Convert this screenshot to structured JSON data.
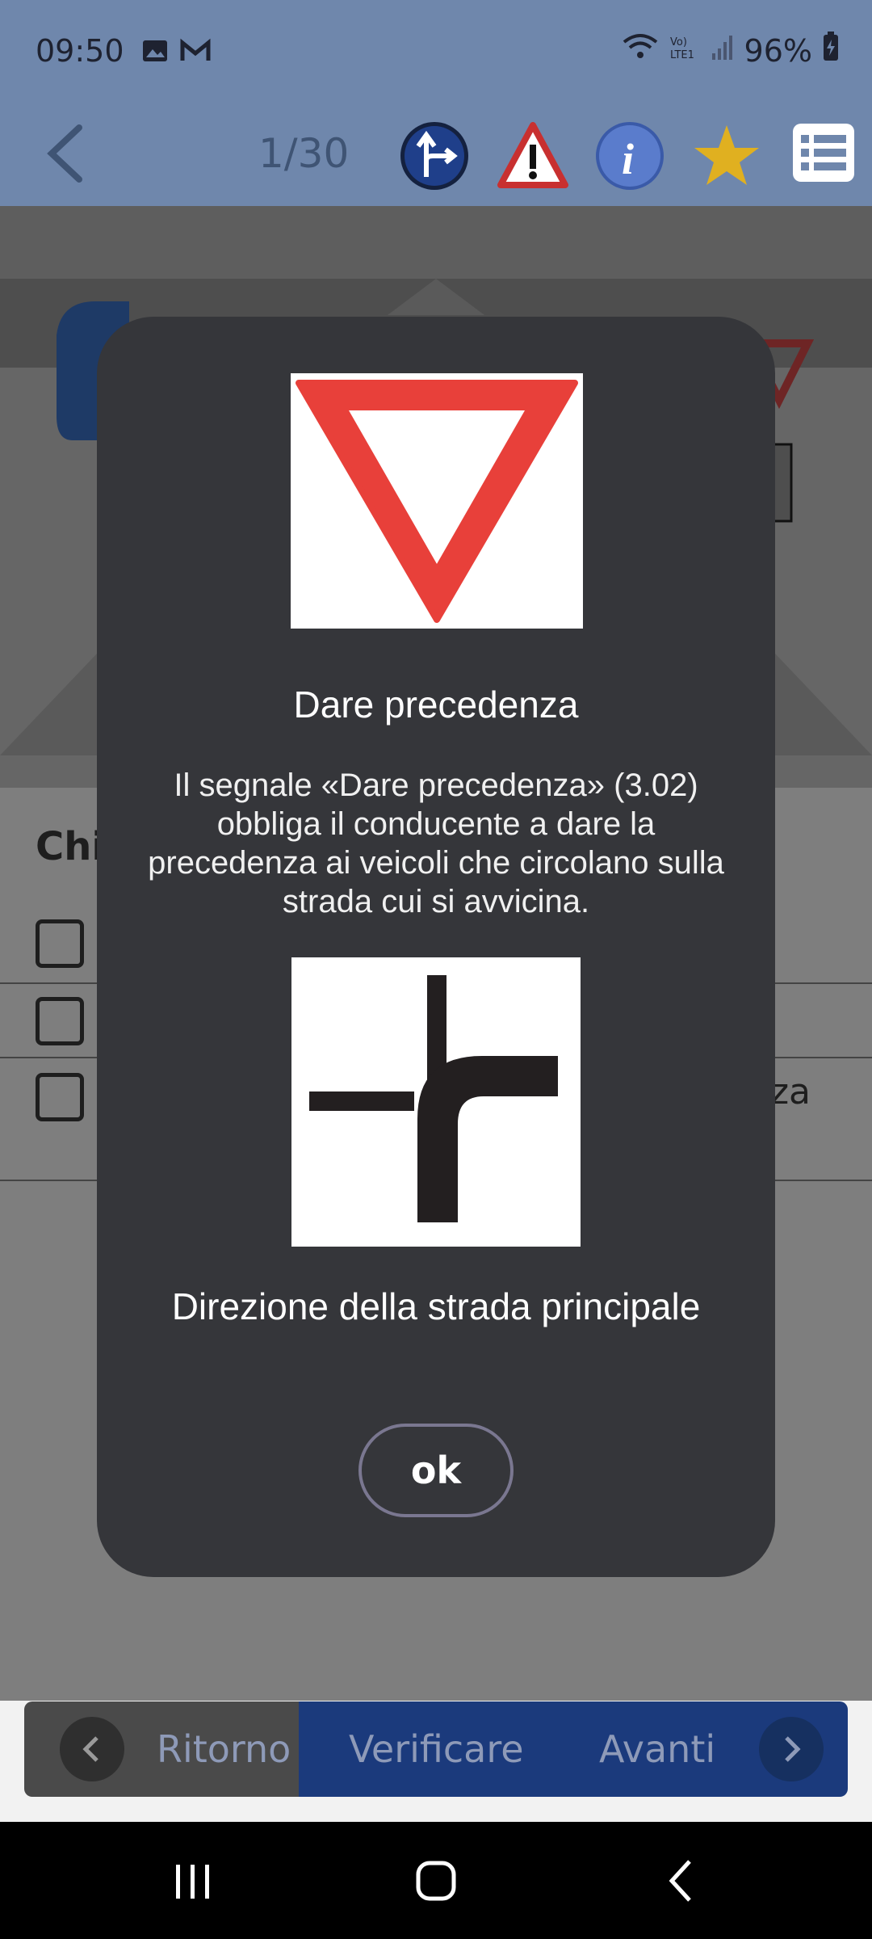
{
  "status_bar": {
    "time": "09:50",
    "battery": "96%",
    "icons": [
      "image-icon",
      "gmail-icon",
      "wifi-icon",
      "volte-icon",
      "signal-icon",
      "battery-icon"
    ]
  },
  "toolbar": {
    "counter": "1/30",
    "icons": [
      "back-icon",
      "direction-sign-icon",
      "warning-sign-icon",
      "info-icon",
      "star-icon",
      "list-icon"
    ]
  },
  "question": {
    "title_partial": "Chi",
    "answer3_partial": "za"
  },
  "dialog": {
    "sign1_title": "Dare precedenza",
    "sign1_description": "Il segnale «Dare precedenza» (3.02) obbliga il conducente a dare la precedenza ai veicoli che circolano sulla strada cui si avvicina.",
    "sign2_title": "Direzione della strada principale",
    "ok_label": "ok"
  },
  "bottom_nav": {
    "back_label": "Ritorno",
    "check_label": "Verificare",
    "next_label": "Avanti"
  },
  "colors": {
    "header": "#6f87ac",
    "dialog_bg": "#35363a",
    "nav_blue": "#1b3a7c",
    "sign_red": "#e8403a"
  }
}
